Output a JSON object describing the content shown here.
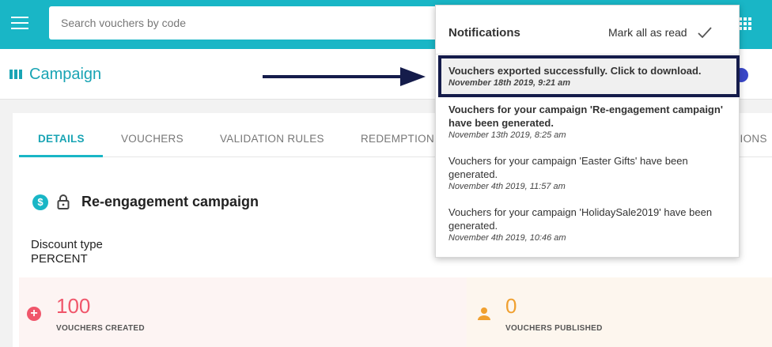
{
  "search": {
    "placeholder": "Search vouchers by code"
  },
  "header": {
    "title": "Campaign"
  },
  "tabs": [
    {
      "label": "DETAILS"
    },
    {
      "label": "VOUCHERS"
    },
    {
      "label": "VALIDATION RULES"
    },
    {
      "label": "REDEMPTION"
    },
    {
      "label": "TIONS"
    }
  ],
  "campaign": {
    "name": "Re-engagement campaign",
    "discount_type_label": "Discount type",
    "discount_type_value": "PERCENT"
  },
  "stats": {
    "created_value": "100",
    "created_label": "VOUCHERS CREATED",
    "published_value": "0",
    "published_label": "VOUCHERS PUBLISHED"
  },
  "notifications": {
    "title": "Notifications",
    "mark_all_label": "Mark all as read",
    "items": [
      {
        "message": "Vouchers exported successfully. Click to download.",
        "time": "November 18th 2019, 9:21 am"
      },
      {
        "message": "Vouchers for your campaign 'Re-engagement campaign' have been generated.",
        "time": "November 13th 2019, 8:25 am"
      },
      {
        "message": "Vouchers for your campaign 'Easter Gifts' have been generated.",
        "time": "November 4th 2019, 11:57 am"
      },
      {
        "message": "Vouchers for your campaign 'HolidaySale2019' have been generated.",
        "time": "November 4th 2019, 10:46 am"
      }
    ]
  },
  "colors": {
    "brand": "#19b6c6",
    "highlight_border": "#151c4b",
    "created": "#f0566b",
    "published": "#f0a030"
  },
  "icons": [
    "menu-icon",
    "apps-grid-icon",
    "campaign-icon",
    "dollar-icon",
    "lock-icon",
    "plus-icon",
    "person-icon",
    "check-icon",
    "arrow-icon"
  ]
}
